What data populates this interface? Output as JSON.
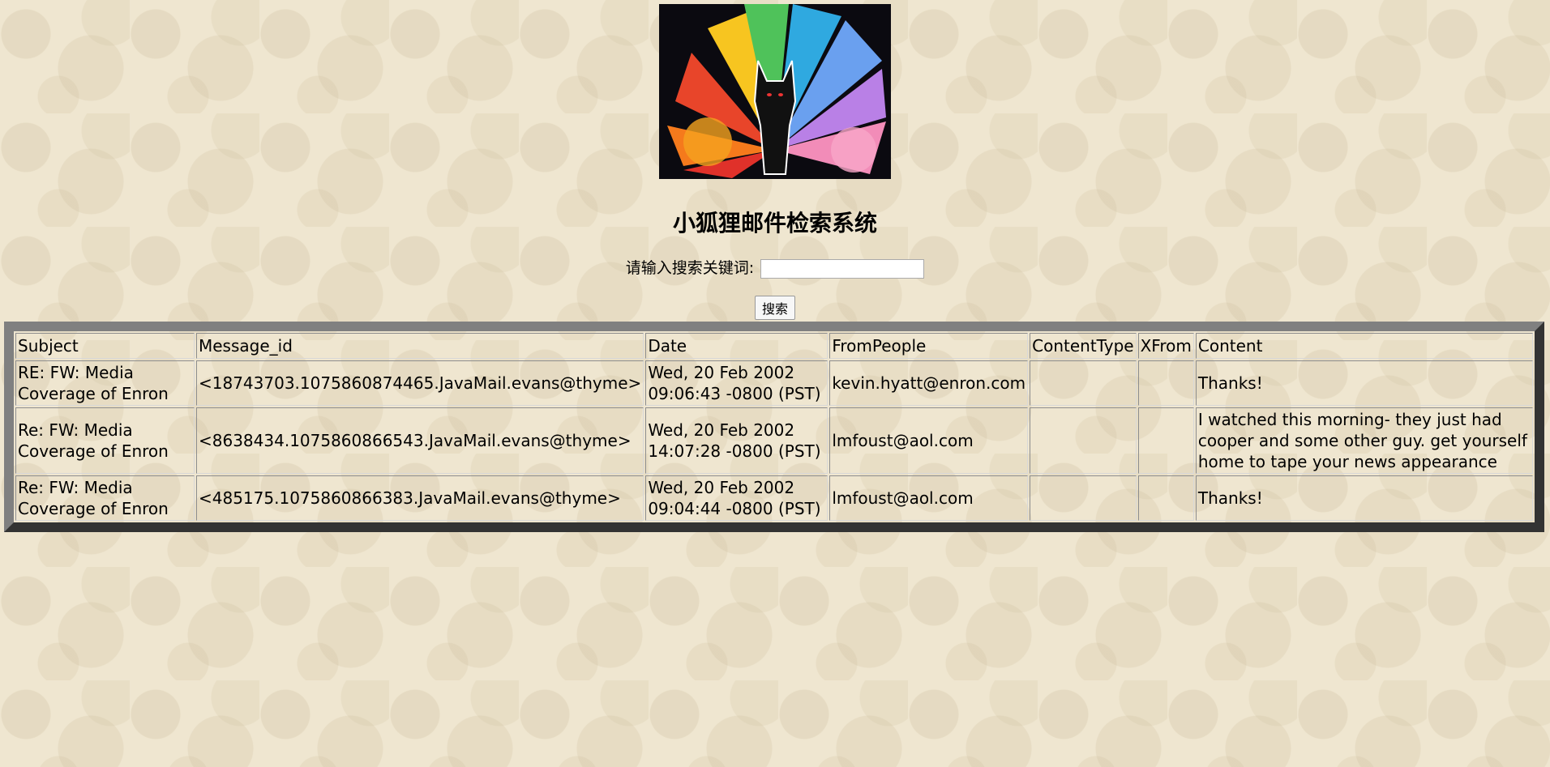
{
  "header": {
    "logo_icon": "nine-tailed-fox-logo",
    "title": "小狐狸邮件检索系统"
  },
  "search": {
    "label": "请输入搜索关键词:",
    "value": "",
    "placeholder": "",
    "button_label": "搜索"
  },
  "table": {
    "headers": [
      "Subject",
      "Message_id",
      "Date",
      "FromPeople",
      "ContentType",
      "XFrom",
      "Content"
    ],
    "rows": [
      {
        "subject": "RE: FW: Media Coverage of Enron",
        "message_id": "<18743703.1075860874465.JavaMail.evans@thyme>",
        "date": "Wed, 20 Feb 2002 09:06:43 -0800 (PST)",
        "from": "kevin.hyatt@enron.com",
        "content_type": "",
        "xfrom": "",
        "content": "Thanks!"
      },
      {
        "subject": "Re: FW: Media Coverage of Enron",
        "message_id": "<8638434.1075860866543.JavaMail.evans@thyme>",
        "date": "Wed, 20 Feb 2002 14:07:28 -0800 (PST)",
        "from": "lmfoust@aol.com",
        "content_type": "",
        "xfrom": "",
        "content": "I watched this morning- they just had cooper and some other guy. get yourself home to tape your news appearance"
      },
      {
        "subject": "Re: FW: Media Coverage of Enron",
        "message_id": "<485175.1075860866383.JavaMail.evans@thyme>",
        "date": "Wed, 20 Feb 2002 09:04:44 -0800 (PST)",
        "from": "lmfoust@aol.com",
        "content_type": "",
        "xfrom": "",
        "content": "Thanks!"
      }
    ]
  }
}
